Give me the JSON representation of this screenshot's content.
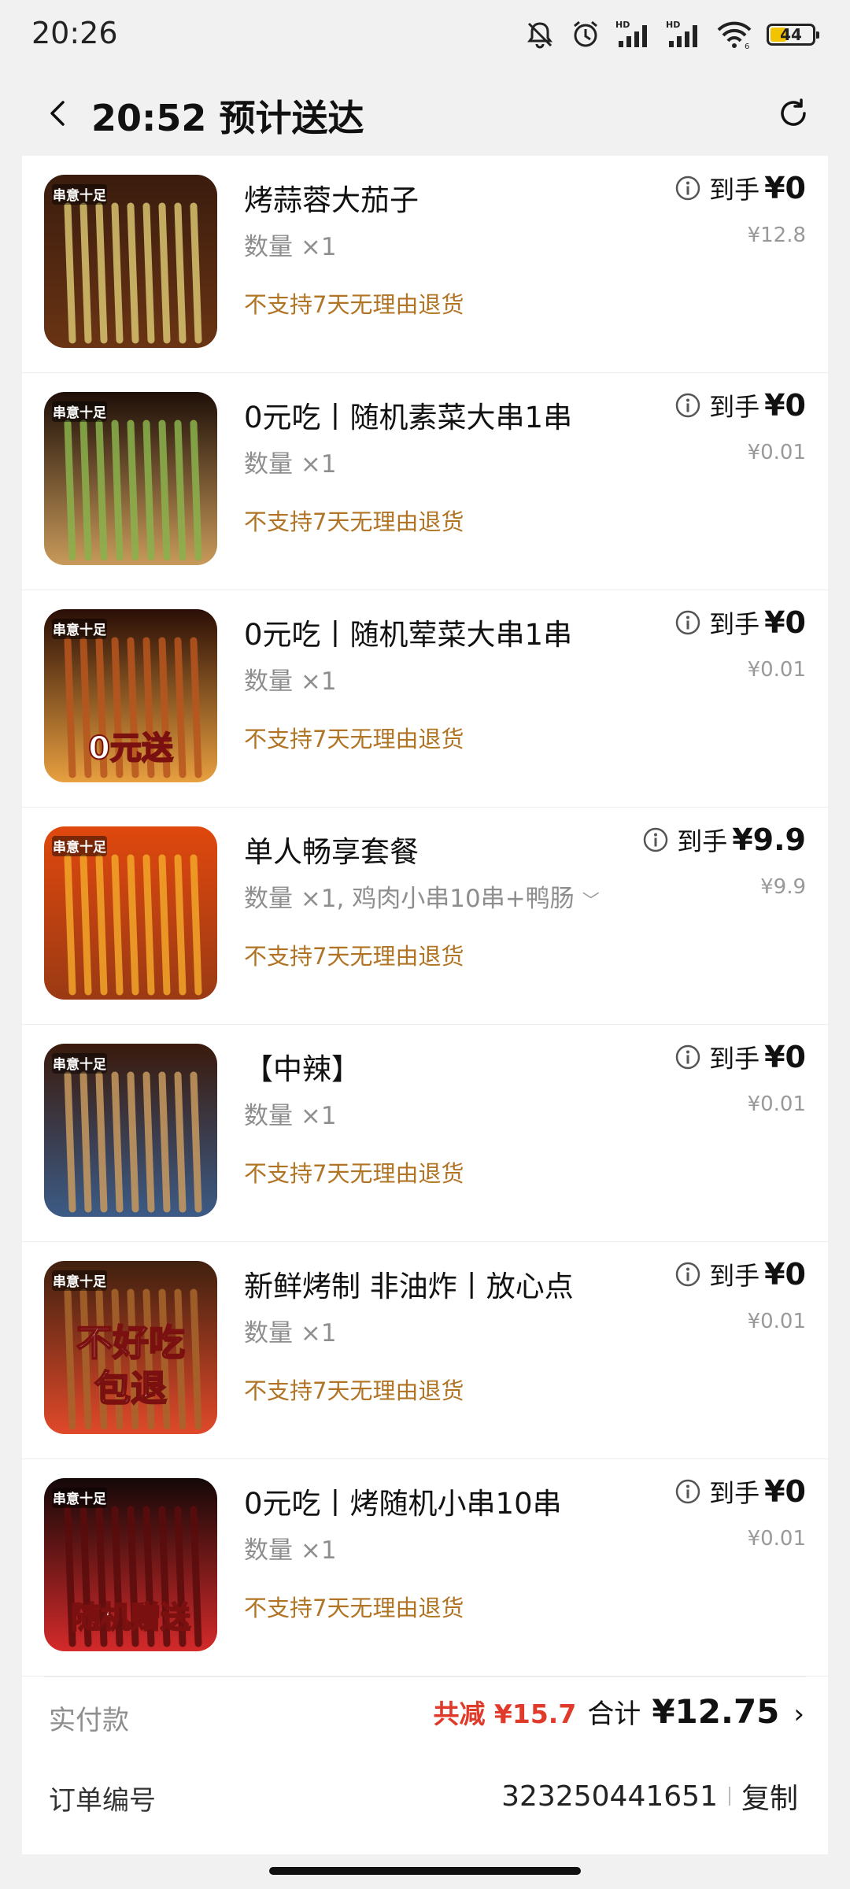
{
  "status_bar": {
    "time": "20:26",
    "icons": [
      "mute-icon",
      "alarm-icon",
      "signal-hd-icon",
      "signal-hd-icon",
      "wifi-icon",
      "battery-icon"
    ],
    "battery": "44"
  },
  "header": {
    "title": "20:52 预计送达",
    "back_icon": "chevron-left-icon",
    "refresh_icon": "refresh-icon"
  },
  "items": [
    {
      "name": "烤蒜蓉大茄子",
      "qty": "数量 ×1",
      "policy": "不支持7天无理由退货",
      "price_label": "到手",
      "price": "¥0",
      "orig_price": "¥12.8",
      "thumb_colors": [
        "#3a1c0e",
        "#d8c470",
        "#6a3414"
      ],
      "thumb_text": ""
    },
    {
      "name": "0元吃丨随机素菜大串1串",
      "qty": "数量 ×1",
      "policy": "不支持7天无理由退货",
      "price_label": "到手",
      "price": "¥0",
      "orig_price": "¥0.01",
      "thumb_colors": [
        "#1e0f08",
        "#8bb24c",
        "#c89a5a"
      ],
      "thumb_text": ""
    },
    {
      "name": "0元吃丨随机荤菜大串1串",
      "qty": "数量 ×1",
      "policy": "不支持7天无理由退货",
      "price_label": "到手",
      "price": "¥0",
      "orig_price": "¥0.01",
      "thumb_colors": [
        "#2a0e06",
        "#b8561f",
        "#e8a040"
      ],
      "thumb_text": "0元送"
    },
    {
      "name": "单人畅享套餐",
      "qty": "数量 ×1, 鸡肉小串10串+鸭肠",
      "policy": "不支持7天无理由退货",
      "price_label": "到手",
      "price": "¥9.9",
      "orig_price": "¥9.9",
      "thumb_colors": [
        "#e0480e",
        "#f3a62a",
        "#9a3a14"
      ],
      "thumb_text": "",
      "has_dropdown": true
    },
    {
      "name": "【中辣】",
      "qty": "数量 ×1",
      "policy": "不支持7天无理由退货",
      "price_label": "到手",
      "price": "¥0",
      "orig_price": "¥0.01",
      "thumb_colors": [
        "#3a1a0c",
        "#c89a60",
        "#3c5b86"
      ],
      "thumb_text": ""
    },
    {
      "name": "新鲜烤制 非油炸丨放心点",
      "qty": "数量 ×1",
      "policy": "不支持7天无理由退货",
      "price_label": "到手",
      "price": "¥0",
      "orig_price": "¥0.01",
      "thumb_colors": [
        "#40210f",
        "#a8662c",
        "#e0492a"
      ],
      "thumb_text": "不好吃\n包退"
    },
    {
      "name": "0元吃丨烤随机小串10串",
      "qty": "数量 ×1",
      "policy": "不支持7天无理由退货",
      "price_label": "到手",
      "price": "¥0",
      "orig_price": "¥0.01",
      "thumb_colors": [
        "#140808",
        "#5a0c0c",
        "#d42a2a"
      ],
      "thumb_text": "随机赠送"
    }
  ],
  "summary": {
    "pay_label": "实付款",
    "discount": "共减 ¥15.7",
    "total_label": "合计",
    "total": "¥12.75",
    "order_label": "订单编号",
    "order_no": "323250441651",
    "copy": "复制"
  }
}
